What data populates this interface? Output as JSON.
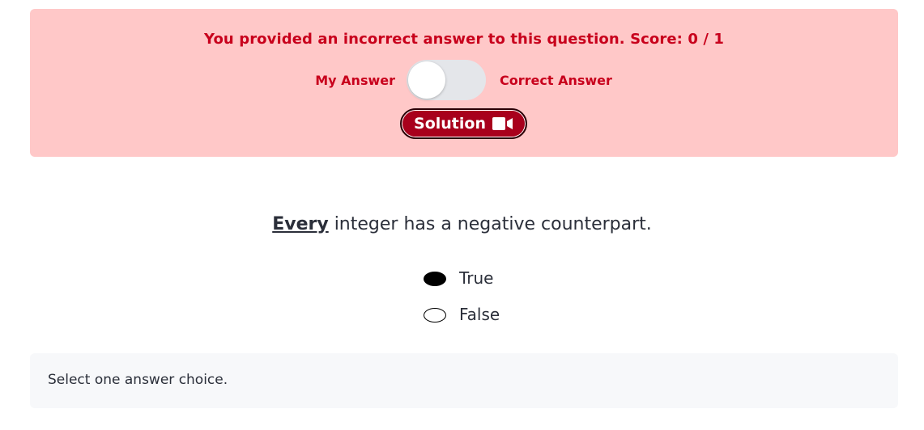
{
  "feedback": {
    "message": "You provided an incorrect answer to this question. Score: 0 / 1",
    "toggle": {
      "left_label": "My Answer",
      "right_label": "Correct Answer",
      "selected": "My Answer"
    },
    "solution_label": "Solution",
    "solution_icon": "video-camera-icon"
  },
  "question": {
    "emphasis": "Every",
    "rest": " integer has a negative counterpart."
  },
  "options": [
    {
      "label": "True",
      "selected": true
    },
    {
      "label": "False",
      "selected": false
    }
  ],
  "hint": "Select one answer choice.",
  "colors": {
    "banner_bg": "#ffc8c8",
    "error_text": "#c8001c",
    "solution_button": "#a8001c",
    "hint_bg": "#f7f8fa"
  }
}
